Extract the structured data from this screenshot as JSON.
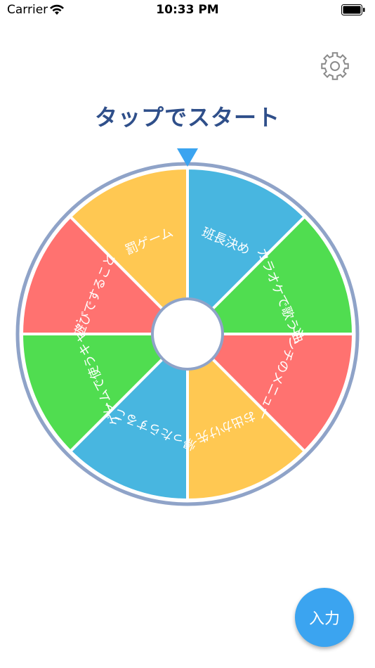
{
  "status_bar": {
    "carrier": "Carrier",
    "time": "10:33 PM"
  },
  "title": "タップでスタート",
  "input_button": {
    "label": "入力"
  },
  "icons": {
    "settings": "gear-icon",
    "pointer": "triangle-pointer-icon",
    "wifi": "wifi-icon",
    "battery": "battery-icon"
  },
  "colors": {
    "title": "#2f4f8a",
    "ring": "#8fa3c8",
    "pointer": "#3ba4f0",
    "fab": "#3ba4f0"
  },
  "wheel": {
    "segments": [
      {
        "label": "班長決め",
        "color": "#48b6e0"
      },
      {
        "label": "カラオケで歌う曲",
        "color": "#50dd50"
      },
      {
        "label": "ランチのメニュー",
        "color": "#ff7270"
      },
      {
        "label": "お出かけ先",
        "color": "#ffc852"
      },
      {
        "label": "帰ったらすること",
        "color": "#48b6e0"
      },
      {
        "label": "ゲームで使うキャ…",
        "color": "#50dd50"
      },
      {
        "label": "遊びですること",
        "color": "#ff7270"
      },
      {
        "label": "罰ゲーム",
        "color": "#ffc852"
      }
    ]
  }
}
